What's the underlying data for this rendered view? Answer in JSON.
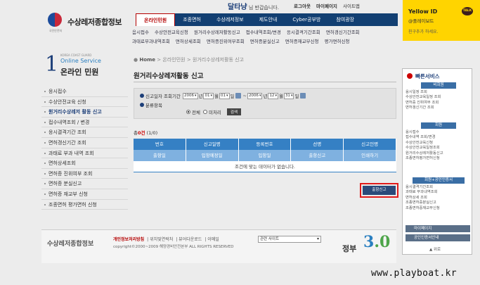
{
  "header": {
    "logo_title": "수상레저종합정보",
    "emblem_caption": "국민안전처",
    "user_name": "달타냥",
    "greeting_suffix": "님 반갑습니다.",
    "util_links": [
      "로그아웃",
      "마이페이지",
      "사이트맵"
    ],
    "gnb": [
      "온라인민원",
      "조종면허",
      "수상레저정보",
      "제도안내",
      "Cyber공부방",
      "참여광장"
    ],
    "subnav": [
      "음시접수",
      "수상안전교육신청",
      "원거리수상레저활동신고",
      "접수내역조회/변경",
      "응시결격기간조회",
      "면허갱신기간조회",
      "과태료부과내역조회",
      "면허상세조회",
      "면허증진위여부조회",
      "면허증분실신고",
      "면허증재교부신청",
      "평가면허신청"
    ]
  },
  "yellow_panel": {
    "title": "Yellow ID",
    "subtitle": "@플레이보트",
    "note": "친구추가 하세요.",
    "badge": "TALK"
  },
  "sidebar": {
    "number": "1",
    "small_caption": "KOREA COAST GUARD",
    "eng": "Online Service",
    "kor": "온라인 민원",
    "items": [
      "응시접수",
      "수상안전교육 신청",
      "원거리수상레저 활동 신고",
      "접수내역조회 / 변경",
      "응시결격기간 조회",
      "면허갱신기간 조회",
      "과태료 부과 내역 조회",
      "면허상세조회",
      "면허증 진위여부 조회",
      "면허증 분실신고",
      "면허증 재교부 신청",
      "조종면허 평가면허 신청"
    ]
  },
  "main": {
    "breadcrumb": [
      "Home",
      "온라인민원",
      "원거리수상레저활동 신고"
    ],
    "title": "원거리수상레저활동 신고",
    "search": {
      "period_label": "신고일자 조회기간",
      "from": {
        "year": "2006",
        "year_unit": "년",
        "month": "01",
        "month_unit": "월",
        "day": "01",
        "day_unit": "일"
      },
      "to": {
        "year": "2006",
        "year_unit": "년",
        "month": "12",
        "month_unit": "월",
        "day": "31",
        "day_unit": "일"
      },
      "range_sep": "~",
      "category_label": "분류항목",
      "radio_all": "전체",
      "radio_pending": "미처리",
      "search_button": "검색"
    },
    "total_prefix": "총",
    "total_count": "0건",
    "total_pages": "(1/0)",
    "table": {
      "headers": [
        "번호",
        "신고일명",
        "등록번호",
        "선명",
        "신고인명"
      ],
      "subheaders": [
        "출항일",
        "입항예정일",
        "입항일",
        "출항신고",
        "인쇄하기"
      ],
      "empty_message": "조건에 맞는 데이터가 없습니다."
    },
    "report_button": "출항신고"
  },
  "quick": {
    "title": "빠른서비스",
    "sec1": "비회원",
    "list1": [
      "응시일정 조회",
      "수상안전교육일정 조회",
      "면허증 진위여부 조회",
      "면허갱신기간 조회"
    ],
    "sec2": "회원",
    "list2": [
      "응시접수",
      "접수내역 조회/변경",
      "수상안전교육신청",
      "수상안전교육일정조회",
      "원거리수상레저활동신고",
      "조종면허평가면허신청"
    ],
    "sec3": "회원+공인인증서",
    "list3": [
      "응시결격기간조회",
      "과태료 부과내역조회",
      "면허상세 조회",
      "조종면허증분실신고",
      "조종면허증재교부신청"
    ],
    "bar1": "마이페이지",
    "bar2": "공인인증서안내",
    "top": "▲ 위로"
  },
  "footer": {
    "logo": "수상레저종합정보",
    "links": [
      "개인정보처리방침",
      "위치및연락처",
      "뷰어다운로드",
      "이메일"
    ],
    "copyright": "copyright©2000~2009 해양경비안전본부 ALL RIGHTS RESERVED",
    "select": "관련 사이트",
    "mark_word": "정부",
    "mark_num_a": "3",
    "mark_num_b": ".0"
  },
  "watermark": "www.playboat.kr"
}
